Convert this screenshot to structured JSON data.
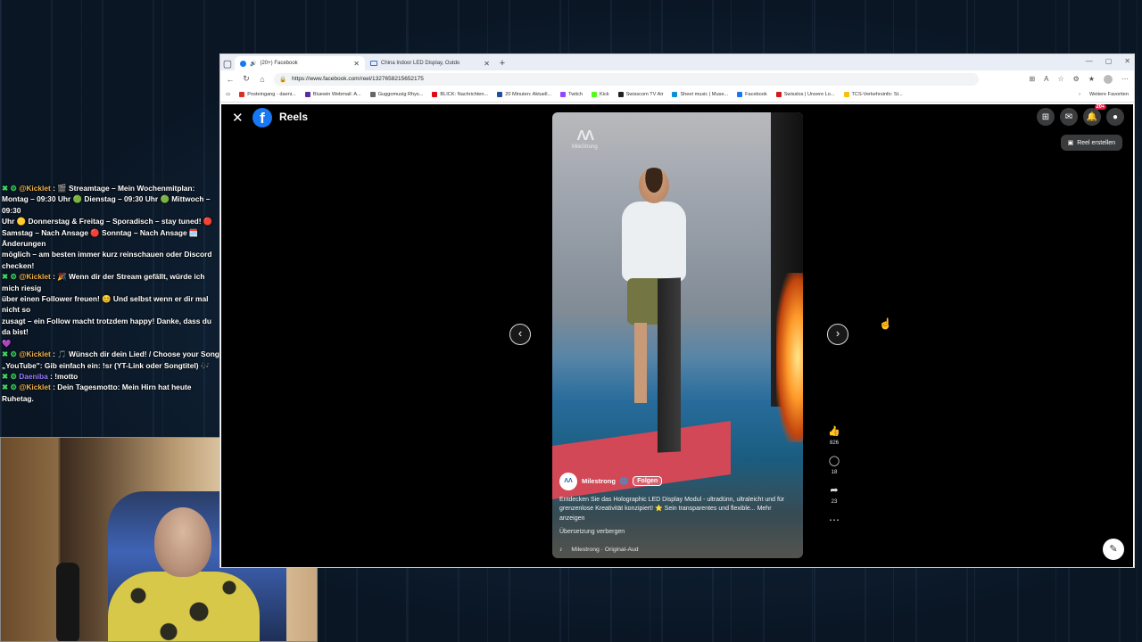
{
  "chat": {
    "lines": [
      {
        "user": "@Kicklet",
        "text": " : 🎬 Streamtage – Mein Wochenmitplan:"
      },
      {
        "user": "",
        "text": "Montag – 09:30 Uhr 🟢 Dienstag – 09:30 Uhr 🟢 Mittwoch – 09:30"
      },
      {
        "user": "",
        "text": "Uhr 🟡 Donnerstag & Freitag – Sporadisch – stay tuned! 🔴"
      },
      {
        "user": "",
        "text": "Samstag – Nach Ansage 🔴 Sonntag – Nach Ansage 🗓️ Änderungen"
      },
      {
        "user": "",
        "text": "möglich – am besten immer kurz reinschauen oder Discord checken!"
      },
      {
        "user": "@Kicklet",
        "text": " : 🎉 Wenn dir der Stream gefällt, würde ich mich riesig"
      },
      {
        "user": "",
        "text": "über einen Follower freuen! 😊 Und selbst wenn er dir mal nicht so"
      },
      {
        "user": "",
        "text": "zusagt – ein Follow macht trotzdem happy! Danke, dass du da bist!"
      },
      {
        "user": "",
        "text": "💜"
      },
      {
        "user": "@Kicklet",
        "text": " : 🎵 Wünsch dir dein Lied! / Choose your Song"
      },
      {
        "user": "",
        "text": "„YouTube\": Gib einfach ein: !sr (YT-Link oder Songtitel) 🎶"
      },
      {
        "user": "Daeniba",
        "text": " : !motto",
        "purple": true
      },
      {
        "user": "@Kicklet",
        "text": " : Dein Tagesmotto: Mein Hirn hat heute Ruhetag."
      }
    ]
  },
  "browser": {
    "tabs": [
      {
        "label": "(20+) Facebook",
        "active": true
      },
      {
        "label": "China Indoor LED Display, Outdo",
        "active": false
      }
    ],
    "new_tab": "+",
    "url": "https://www.facebook.com/reel/1327658215652175",
    "favorites": [
      {
        "label": "Posteingang - daeni...",
        "color": "#d93025"
      },
      {
        "label": "Bluewin Webmail: A...",
        "color": "#5a2ca0"
      },
      {
        "label": "Guggomusig Rhys...",
        "color": "#666666"
      },
      {
        "label": "BLICK: Nachrichten...",
        "color": "#e30613"
      },
      {
        "label": "20 Minuten: Aktuell...",
        "color": "#1c4fa0"
      },
      {
        "label": "Twitch",
        "color": "#9146ff"
      },
      {
        "label": "Kick",
        "color": "#53fc18"
      },
      {
        "label": "Swisscom TV Air",
        "color": "#222222"
      },
      {
        "label": "Sheet music | Muse...",
        "color": "#0b8fd8"
      },
      {
        "label": "Facebook",
        "color": "#1877f2"
      },
      {
        "label": "Swisslos | Unsere Lo...",
        "color": "#d41a1a"
      },
      {
        "label": "TCS-Verkehrsinfo: St...",
        "color": "#f4c20d"
      }
    ],
    "more_favorites": "Weitere Favoriten"
  },
  "reels": {
    "title": "Reels",
    "create_label": "Reel erstellen",
    "notif_count": "20+",
    "author": "Milestrong",
    "follow": "Folgen",
    "watermark": "MileStrong",
    "caption": "Entdecken Sie das Holographic LED Display Modul - ultradünn, ultraleicht und für grenzenlose Kreativität konzipiert! ⭐ Sein transparentes und flexible...",
    "more": "Mehr anzeigen",
    "translate": "Übersetzung verbergen",
    "audio": "Milestrong · Original-Aud",
    "likes": "826",
    "comments": "18",
    "shares": "23"
  }
}
